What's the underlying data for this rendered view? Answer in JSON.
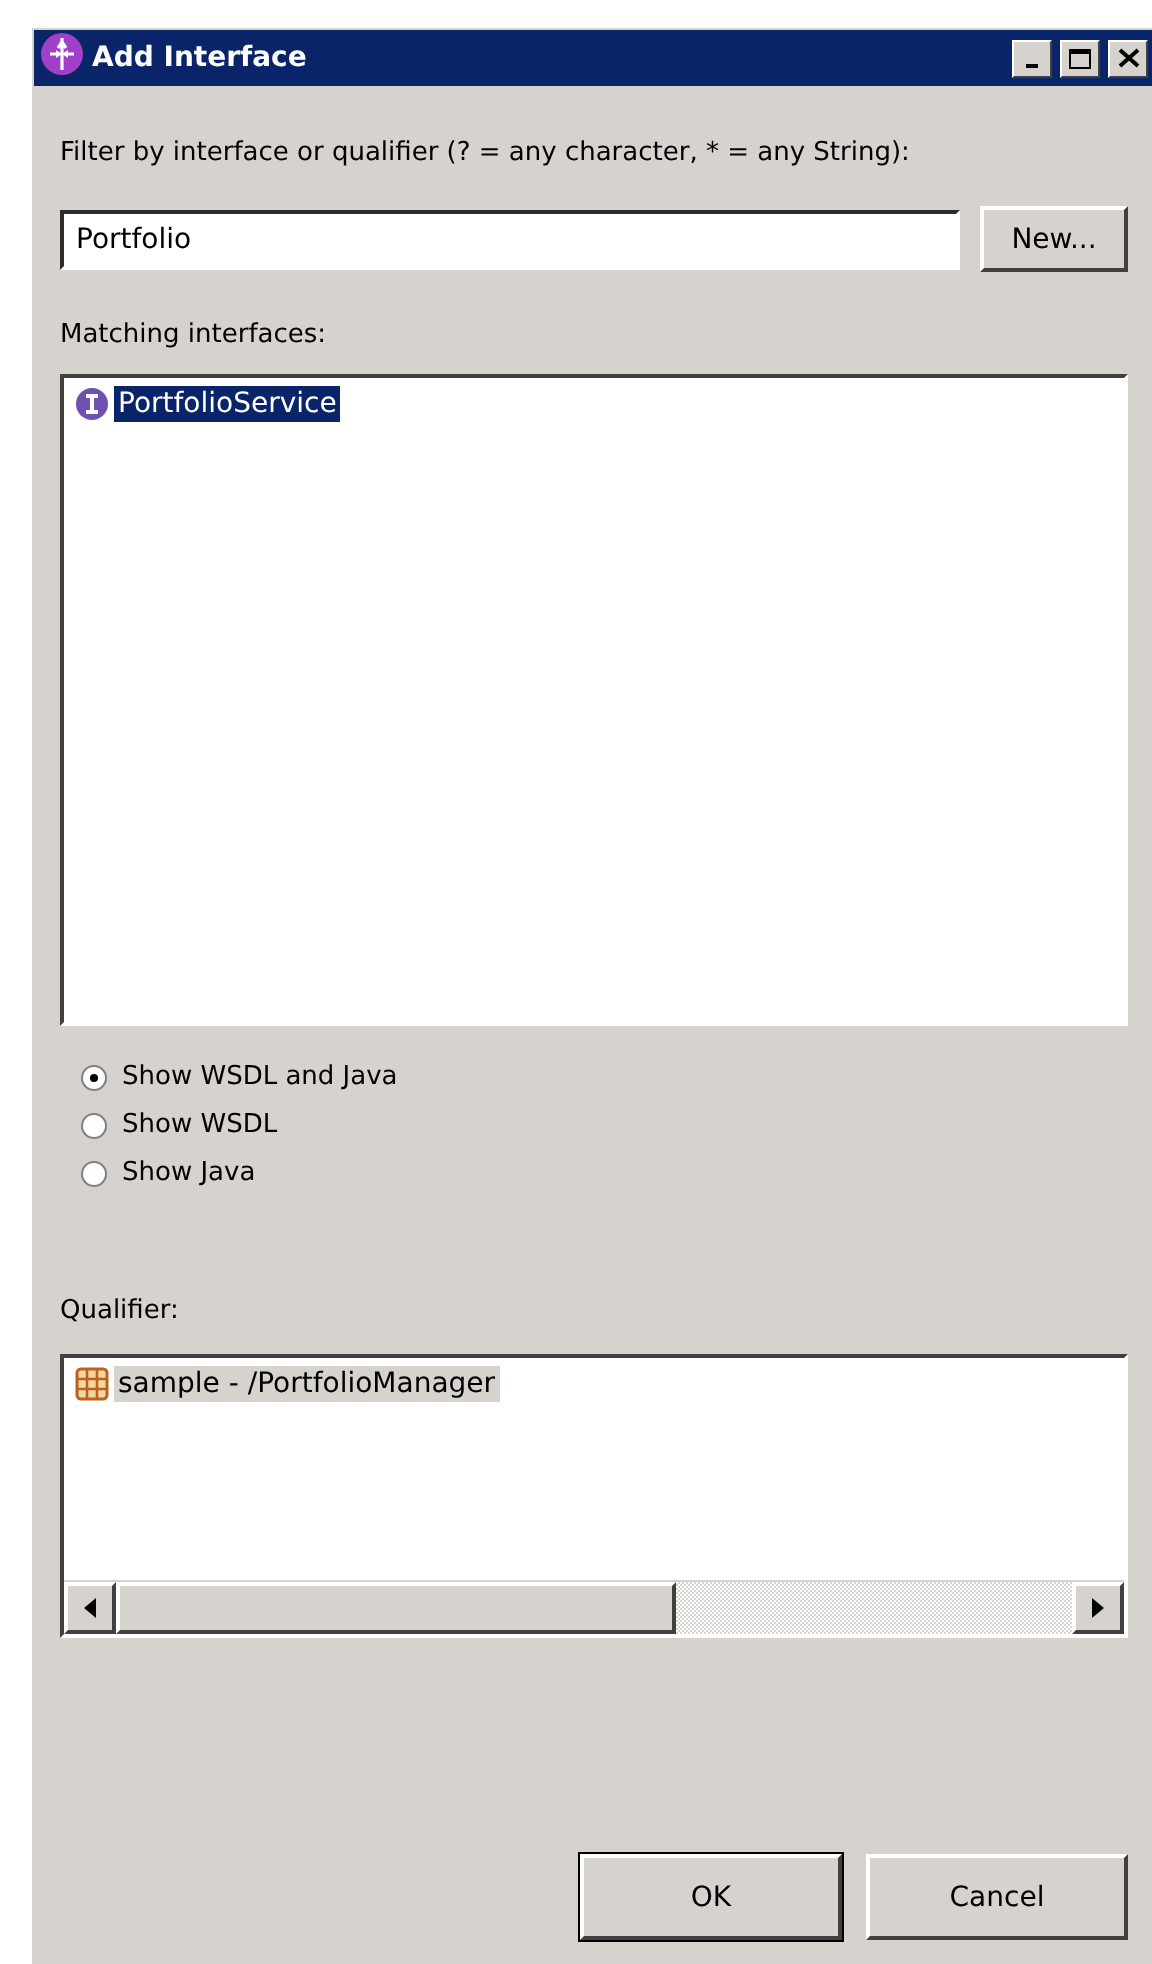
{
  "window": {
    "title": "Add Interface"
  },
  "filter": {
    "label": "Filter by interface or qualifier (? = any character, * = any String):",
    "value": "Portfolio"
  },
  "new_button": {
    "label": "New..."
  },
  "matching": {
    "label": "Matching interfaces:",
    "focused": true,
    "items": [
      {
        "text": "PortfolioService",
        "selected": true
      }
    ]
  },
  "view_options": [
    {
      "label": "Show WSDL and Java",
      "selected": true
    },
    {
      "label": "Show WSDL",
      "selected": false
    },
    {
      "label": "Show Java",
      "selected": false
    }
  ],
  "qualifier": {
    "label": "Qualifier:",
    "focused": false,
    "items": [
      {
        "text": "sample - /PortfolioManager",
        "selected": true
      }
    ]
  },
  "buttons": [
    {
      "label": "OK",
      "default": true
    },
    {
      "label": "Cancel",
      "default": false
    }
  ]
}
